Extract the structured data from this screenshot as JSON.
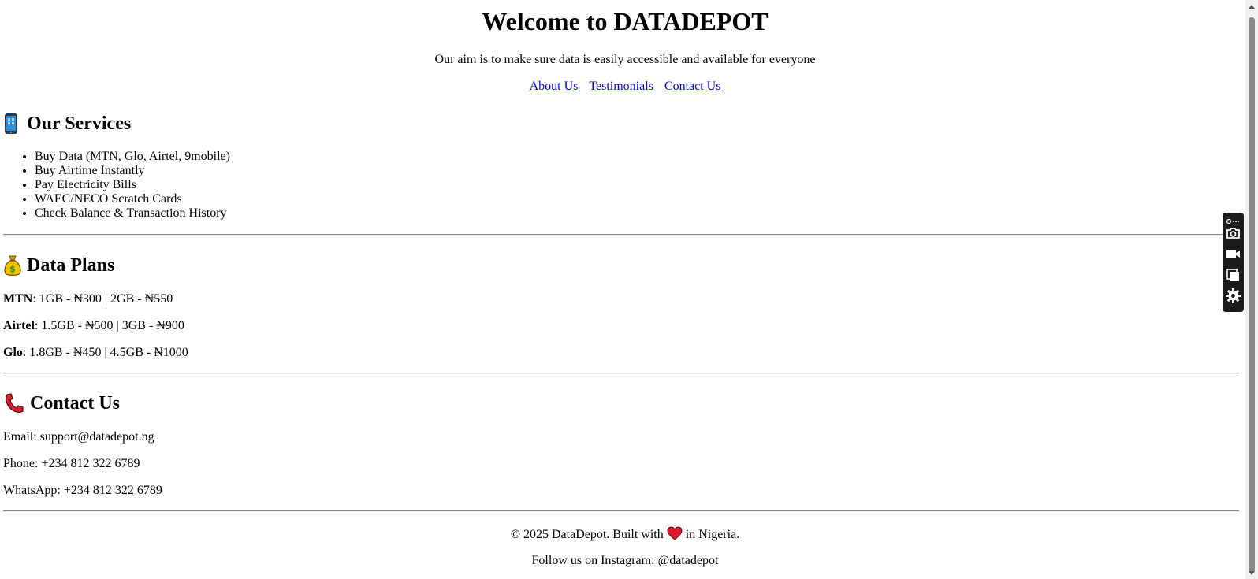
{
  "header": {
    "title": "Welcome to DATADEPOT",
    "aim": "Our aim is to make sure data is easily accessible and available for everyone",
    "nav": [
      {
        "label": "About Us"
      },
      {
        "label": "Testimonials"
      },
      {
        "label": "Contact Us"
      }
    ]
  },
  "services": {
    "heading": "Our Services",
    "icon": "mobile-phone-icon",
    "items": [
      "Buy Data (MTN, Glo, Airtel, 9mobile)",
      "Buy Airtime Instantly",
      "Pay Electricity Bills",
      "WAEC/NECO Scratch Cards",
      "Check Balance & Transaction History"
    ]
  },
  "plans": {
    "heading": "Data Plans",
    "icon": "money-bag-icon",
    "rows": [
      {
        "network": "MTN",
        "detail": ": 1GB - ₦300 | 2GB - ₦550"
      },
      {
        "network": "Airtel",
        "detail": ": 1.5GB - ₦500 | 3GB - ₦900"
      },
      {
        "network": "Glo",
        "detail": ": 1.8GB - ₦450 | 4.5GB - ₦1000"
      }
    ]
  },
  "contact": {
    "heading": "Contact Us",
    "icon": "telephone-receiver-icon",
    "email": "Email: support@datadepot.ng",
    "phone": "Phone: +234 812 322 6789",
    "whatsapp": "WhatsApp: +234 812 322 6789"
  },
  "footer": {
    "copyright_prefix": "© 2025 DataDepot. Built with",
    "copyright_suffix": "in Nigeria.",
    "instagram": "Follow us on Instagram: @datadepot"
  },
  "colors": {
    "link": "#0000ee",
    "heart": "#e0182d",
    "toolbar": "#1b1b1b"
  }
}
